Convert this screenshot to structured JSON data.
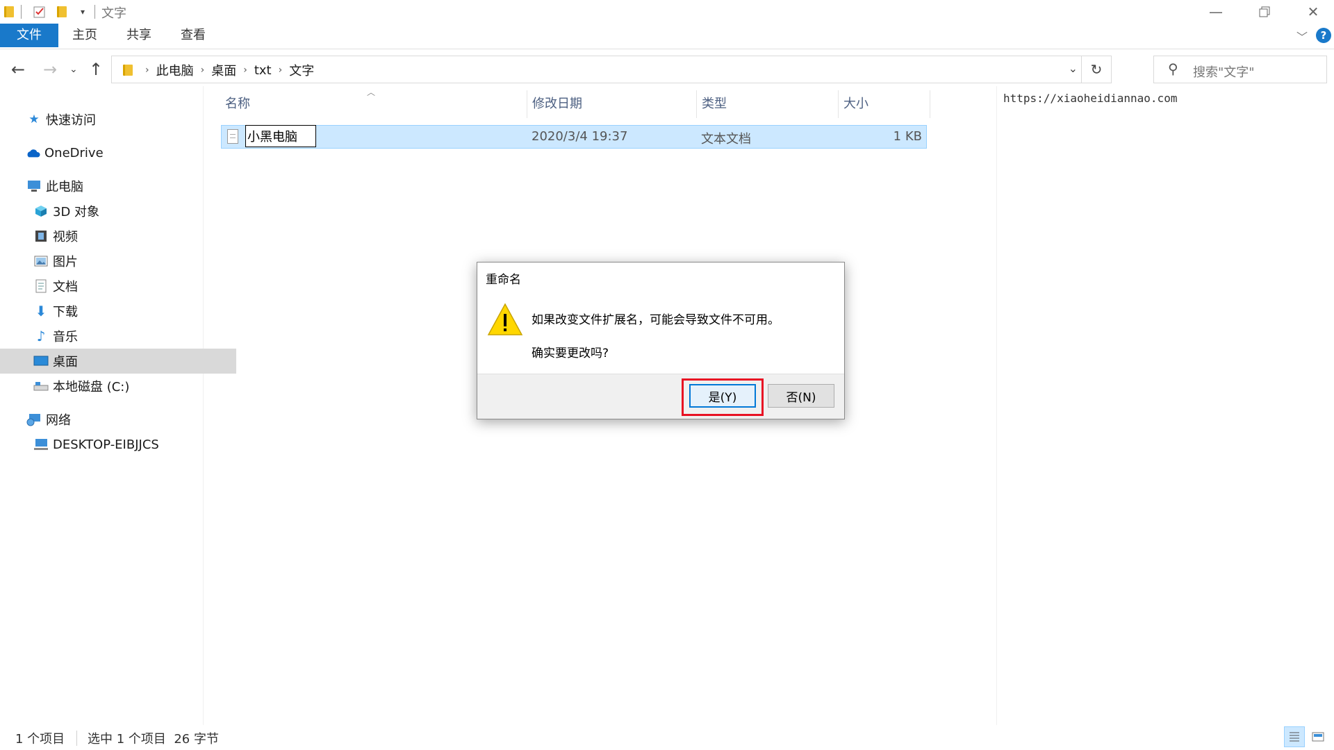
{
  "window": {
    "title": "文字"
  },
  "ribbon": {
    "tabs": [
      "文件",
      "主页",
      "共享",
      "查看"
    ]
  },
  "address": {
    "crumbs": [
      "此电脑",
      "桌面",
      "txt",
      "文字"
    ],
    "search_placeholder": "搜索\"文字\""
  },
  "nav": {
    "items": [
      {
        "label": "快速访问",
        "icon": "star-icon"
      },
      {
        "label": "OneDrive",
        "icon": "cloud-icon"
      },
      {
        "label": "此电脑",
        "icon": "computer-icon"
      },
      {
        "label": "3D 对象",
        "icon": "cube-icon"
      },
      {
        "label": "视频",
        "icon": "film-icon"
      },
      {
        "label": "图片",
        "icon": "picture-icon"
      },
      {
        "label": "文档",
        "icon": "document-icon"
      },
      {
        "label": "下载",
        "icon": "download-icon"
      },
      {
        "label": "音乐",
        "icon": "music-icon"
      },
      {
        "label": "桌面",
        "icon": "desktop-icon",
        "selected": true
      },
      {
        "label": "本地磁盘 (C:)",
        "icon": "drive-icon"
      },
      {
        "label": "网络",
        "icon": "network-icon"
      },
      {
        "label": "DESKTOP-EIBJJCS",
        "icon": "pc-icon"
      }
    ]
  },
  "list": {
    "columns": [
      "名称",
      "修改日期",
      "类型",
      "大小"
    ],
    "rows": [
      {
        "name": "小黑电脑",
        "modified": "2020/3/4 19:37",
        "type": "文本文档",
        "size": "1 KB"
      }
    ]
  },
  "preview": {
    "text": "https://xiaoheidiannao.com"
  },
  "status": {
    "count": "1 个项目",
    "selection": "选中 1 个项目  26 字节"
  },
  "dialog": {
    "title": "重命名",
    "message": "如果改变文件扩展名，可能会导致文件不可用。",
    "question": "确实要更改吗?",
    "yes_label": "是(Y)",
    "no_label": "否(N)"
  },
  "colors": {
    "accent": "#1979ca",
    "selection": "#cce8ff",
    "highlight": "#e81123"
  }
}
